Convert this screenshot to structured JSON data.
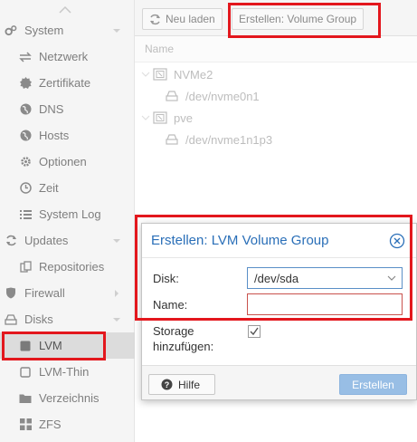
{
  "sidebar": {
    "items": [
      {
        "label": "System",
        "icon": "gears-icon"
      },
      {
        "label": "Netzwerk",
        "icon": "exchange-icon"
      },
      {
        "label": "Zertifikate",
        "icon": "certificate-icon"
      },
      {
        "label": "DNS",
        "icon": "globe-icon"
      },
      {
        "label": "Hosts",
        "icon": "globe-icon"
      },
      {
        "label": "Optionen",
        "icon": "gear-icon"
      },
      {
        "label": "Zeit",
        "icon": "clock-icon"
      },
      {
        "label": "System Log",
        "icon": "list-icon"
      },
      {
        "label": "Updates",
        "icon": "refresh-icon"
      },
      {
        "label": "Repositories",
        "icon": "files-icon"
      },
      {
        "label": "Firewall",
        "icon": "shield-icon"
      },
      {
        "label": "Disks",
        "icon": "hdd-icon"
      },
      {
        "label": "LVM",
        "icon": "square-icon"
      },
      {
        "label": "LVM-Thin",
        "icon": "square-outline-icon"
      },
      {
        "label": "Verzeichnis",
        "icon": "folder-icon"
      },
      {
        "label": "ZFS",
        "icon": "grid-icon"
      }
    ]
  },
  "toolbar": {
    "reload_label": "Neu laden",
    "create_vg_label": "Erstellen: Volume Group"
  },
  "grid": {
    "column_name": "Name",
    "rows": [
      {
        "label": "NVMe2",
        "icon": "server-icon"
      },
      {
        "label": "/dev/nvme0n1",
        "icon": "hdd-icon"
      },
      {
        "label": "pve",
        "icon": "server-icon"
      },
      {
        "label": "/dev/nvme1n1p3",
        "icon": "hdd-icon"
      }
    ]
  },
  "dialog": {
    "title": "Erstellen: LVM Volume Group",
    "disk_label": "Disk:",
    "disk_value": "/dev/sda",
    "name_label": "Name:",
    "name_value": "",
    "storage_label_line1": "Storage",
    "storage_label_line2": "hinzufügen:",
    "storage_checked": true,
    "help_label": "Hilfe",
    "create_label": "Erstellen"
  },
  "colors": {
    "accent": "#2a6fb8",
    "highlight": "#e3171d",
    "create_button": "#98bee5"
  }
}
